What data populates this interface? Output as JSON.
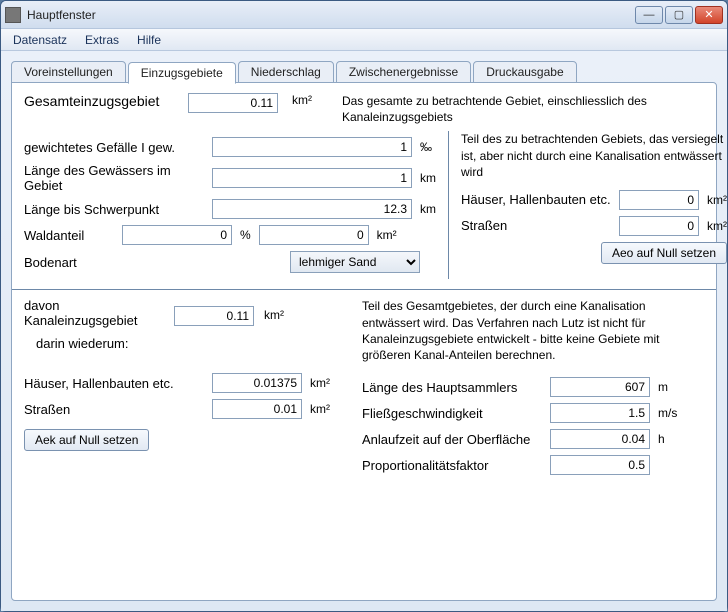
{
  "window": {
    "title": "Hauptfenster"
  },
  "menu": {
    "datensatz": "Datensatz",
    "extras": "Extras",
    "hilfe": "Hilfe"
  },
  "tabs": {
    "voreinstellungen": "Voreinstellungen",
    "einzugsgebiete": "Einzugsgebiete",
    "niederschlag": "Niederschlag",
    "zwischenergebnisse": "Zwischenergebnisse",
    "druckausgabe": "Druckausgabe"
  },
  "top": {
    "label": "Gesamteinzugsgebiet",
    "value": "0.11",
    "unit": "km²",
    "desc": "Das gesamte zu betrachtende Gebiet, einschliesslich des Kanaleinzugsgebiets"
  },
  "left": {
    "gefaelle": {
      "label": "gewichtetes Gefälle I gew.",
      "value": "1",
      "unit": "‰"
    },
    "laenge_gewaesser": {
      "label": "Länge des Gewässers im Gebiet",
      "value": "1",
      "unit": "km"
    },
    "laenge_schwerpunkt": {
      "label": "Länge bis Schwerpunkt",
      "value": "12.3",
      "unit": "km"
    },
    "waldanteil": {
      "label": "Waldanteil",
      "percent": "0",
      "area": "0",
      "unit_pct": "%",
      "unit_area": "km²"
    },
    "bodenart": {
      "label": "Bodenart",
      "selected": "lehmiger Sand"
    }
  },
  "right": {
    "desc": "Teil des zu betrachtenden Gebiets, das versiegelt ist, aber nicht durch eine Kanalisation entwässert wird",
    "haeuser": {
      "label": "Häuser, Hallenbauten etc.",
      "value": "0",
      "unit": "km²"
    },
    "strassen": {
      "label": "Straßen",
      "value": "0",
      "unit": "km²"
    },
    "button": "Aeo auf Null setzen"
  },
  "lower": {
    "davon": {
      "label1": "davon",
      "label2": "Kanaleinzugsgebiet",
      "value": "0.11",
      "unit": "km²"
    },
    "desc": "Teil des Gesamtgebietes, der durch eine Kanalisation entwässert wird. Das Verfahren nach Lutz ist nicht für Kanaleinzugsgebiete entwickelt - bitte keine Gebiete mit größeren Kanal-Anteilen berechnen.",
    "darin": "darin wiederum:",
    "haeuser": {
      "label": "Häuser, Hallenbauten etc.",
      "value": "0.01375",
      "unit": "km²"
    },
    "strassen": {
      "label": "Straßen",
      "value": "0.01",
      "unit": "km²"
    },
    "button": "Aek auf Null setzen",
    "hauptsammler": {
      "label": "Länge des Hauptsammlers",
      "value": "607",
      "unit": "m"
    },
    "fliess": {
      "label": "Fließgeschwindigkeit",
      "value": "1.5",
      "unit": "m/s"
    },
    "anlauf": {
      "label": "Anlaufzeit auf der Oberfläche",
      "value": "0.04",
      "unit": "h"
    },
    "prop": {
      "label": "Proportionalitätsfaktor",
      "value": "0.5",
      "unit": ""
    }
  }
}
